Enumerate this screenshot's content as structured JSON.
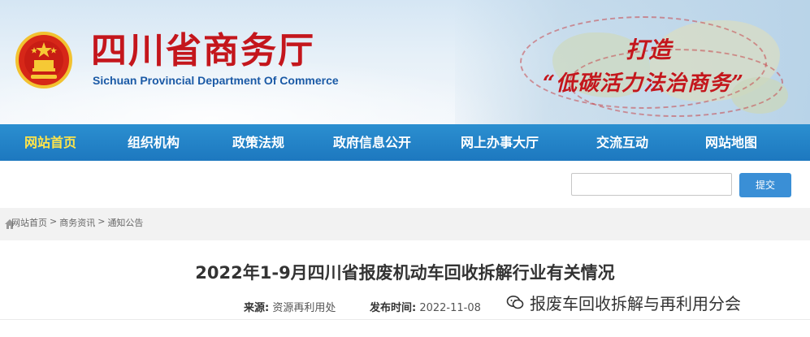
{
  "header": {
    "cn_name": "四川省商务厅",
    "en_name": "Sichuan Provincial Department Of Commerce",
    "slogan_line1": "打造",
    "slogan_line2": "“低碳活力法治商务”"
  },
  "nav": {
    "items": [
      {
        "label": "网站首页",
        "active": true
      },
      {
        "label": "组织机构",
        "active": false
      },
      {
        "label": "政策法规",
        "active": false
      },
      {
        "label": "政府信息公开",
        "active": false
      },
      {
        "label": "网上办事大厅",
        "active": false
      },
      {
        "label": "交流互动",
        "active": false
      },
      {
        "label": "网站地图",
        "active": false
      }
    ]
  },
  "search": {
    "value": "",
    "button_label": "提交"
  },
  "breadcrumb": {
    "items": [
      "网站首页",
      "商务资讯",
      "通知公告"
    ],
    "separator": ">"
  },
  "article": {
    "title": "2022年1-9月四川省报废机动车回收拆解行业有关情况",
    "source_label": "来源:",
    "source_value": "资源再利用处",
    "date_label": "发布时间:",
    "date_value": "2022-11-08"
  },
  "overlay": {
    "watermark_text": "报废车回收拆解与再利用分会"
  },
  "colors": {
    "brand_red": "#c4161c",
    "nav_blue": "#1d78bf",
    "nav_active": "#ffe44a",
    "button_blue": "#3a8fd6"
  }
}
